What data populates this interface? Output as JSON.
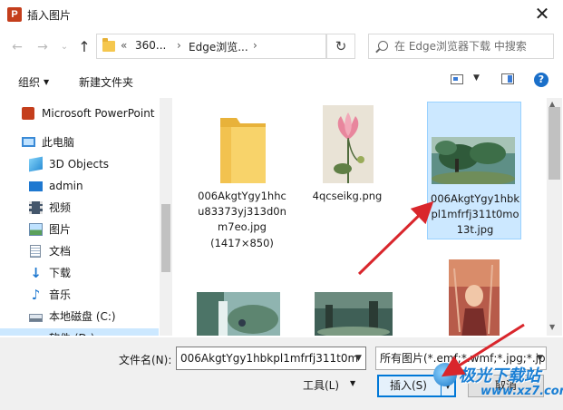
{
  "window": {
    "title": "插入图片",
    "app_icon_letter": "P",
    "close_glyph": "✕"
  },
  "navigation": {
    "back_glyph": "←",
    "forward_glyph": "→",
    "recent_glyph": "⌄",
    "up_glyph": "↑",
    "breadcrumb": [
      "«",
      "360...",
      "›",
      "Edge浏览...",
      "›"
    ],
    "refresh_glyph": "↻",
    "search_placeholder": "在 Edge浏览器下载 中搜索"
  },
  "toolbar": {
    "organize_label": "组织",
    "new_folder_label": "新建文件夹",
    "help_glyph": "?"
  },
  "sidebar": {
    "items": [
      {
        "label": "Microsoft PowerPoint",
        "icon": "powerpoint-icon"
      },
      {
        "label": "此电脑",
        "icon": "computer-icon"
      },
      {
        "label": "3D Objects",
        "icon": "3d-objects-icon"
      },
      {
        "label": "admin",
        "icon": "desktop-icon"
      },
      {
        "label": "视频",
        "icon": "video-icon"
      },
      {
        "label": "图片",
        "icon": "pictures-icon"
      },
      {
        "label": "文档",
        "icon": "documents-icon"
      },
      {
        "label": "下载",
        "icon": "download-icon"
      },
      {
        "label": "音乐",
        "icon": "music-icon"
      },
      {
        "label": "本地磁盘 (C:)",
        "icon": "drive-icon"
      },
      {
        "label": "软件 (D:)",
        "icon": "drive-icon"
      }
    ]
  },
  "files": [
    {
      "name": "006AkgtYgy1hhcu83373yj313d0nm7eo.jpg",
      "extra": "(1417×850)",
      "type": "folder-like-icon",
      "selected": false
    },
    {
      "name": "4qcseikg.png",
      "type": "lotus-image",
      "selected": false
    },
    {
      "name": "006AkgtYgy1hbkpl1mfrfj311t0mo13t.jpg",
      "type": "forest-image",
      "selected": true
    },
    {
      "name": "",
      "type": "waterfall-image",
      "selected": false
    },
    {
      "name": "",
      "type": "ruins-image",
      "selected": false
    },
    {
      "name": "",
      "type": "portrait-image",
      "selected": false
    }
  ],
  "footer": {
    "filename_label": "文件名(N):",
    "filename_value": "006AkgtYgy1hbkpl1mfrfj311t0m",
    "filter_value": "所有图片(*.emf;*.wmf;*.jpg;*.jp",
    "tools_label": "工具(L)",
    "insert_label": "插入(S)",
    "cancel_label": "取消"
  },
  "watermark": {
    "text": "极光下载站",
    "url": "www.xz7.com"
  },
  "colors": {
    "selection": "#cce8ff",
    "accent": "#0078d7",
    "annotation_arrow": "#d9262c"
  }
}
